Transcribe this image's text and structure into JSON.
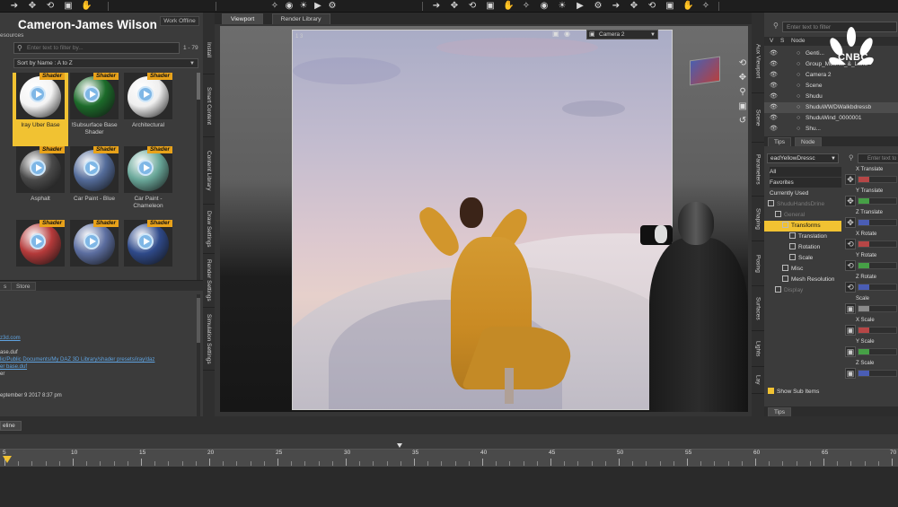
{
  "toolbar": {
    "icons": [
      "select-icon",
      "move-icon",
      "rotate-icon",
      "scale-icon",
      "hand-icon",
      "pan-icon",
      "camera-icon",
      "light-icon",
      "render-icon",
      "settings-icon"
    ]
  },
  "left_panel": {
    "user_name": "Cameron-James Wilson",
    "work_offline": "Work Offline",
    "resources_label": "esources",
    "filter_placeholder": "Enter text to filter by...",
    "count": "1 - 79",
    "sort": "Sort by Name : A to Z",
    "badge_text": "Shader",
    "tiles": [
      {
        "label": "Iray Uber Base",
        "selected": true,
        "color": "#f4f4f4"
      },
      {
        "label": "!Subsurface Base Shader",
        "selected": false,
        "color": "#1c6b2a"
      },
      {
        "label": "Architectural",
        "selected": false,
        "color": "#efefef"
      },
      {
        "label": "Asphalt",
        "selected": false,
        "color": "#4a4a4a"
      },
      {
        "label": "Car Paint - Blue",
        "selected": false,
        "color": "#546c9a"
      },
      {
        "label": "Car Paint - Chameleon",
        "selected": false,
        "color": "#6aa89a"
      },
      {
        "label": "",
        "selected": false,
        "color": "#b53a3a"
      },
      {
        "label": "",
        "selected": false,
        "color": "#5c6ea0"
      },
      {
        "label": "",
        "selected": false,
        "color": "#2f4a8a"
      }
    ],
    "lower_tabs": [
      "s",
      "Store"
    ],
    "info_lines": [
      {
        "text": "z3d.com",
        "link": true
      },
      {
        "text": "",
        "link": false
      },
      {
        "text": "ase.duf",
        "link": false
      },
      {
        "text": "lic/Public Documents/My DAZ 3D Library/shader presets/iray/daz",
        "link": true
      },
      {
        "text": "er base.duf",
        "link": true
      },
      {
        "text": "er",
        "link": false
      },
      {
        "text": "",
        "link": false
      },
      {
        "text": "",
        "link": false
      },
      {
        "text": "eptember 9 2017 8:37 pm",
        "link": false
      }
    ],
    "vtabs": [
      "Install",
      "Smart Content",
      "Content Library",
      "Draw Settings",
      "Render Settings",
      "Simulation Settings"
    ]
  },
  "center": {
    "tabs": [
      {
        "label": "Viewport",
        "active": true
      },
      {
        "label": "Render Library",
        "active": false
      }
    ],
    "camera": "Camera 2",
    "frame_counter": "1 3"
  },
  "right_panel": {
    "vtabs": [
      "Aux Viewport",
      "Scene",
      "Parameters",
      "Shaping",
      "Posing",
      "Surfaces",
      "Lights",
      "Lay"
    ],
    "filter_placeholder": "Enter text to filter",
    "header": {
      "v": "V",
      "s": "S",
      "node": "Node"
    },
    "scene_items": [
      {
        "name": "Genti...",
        "selected": false
      },
      {
        "name": "Group_Mounts_&_Land",
        "selected": false
      },
      {
        "name": "Camera 2",
        "selected": false
      },
      {
        "name": "Scene",
        "selected": false
      },
      {
        "name": "Shudu",
        "selected": false
      },
      {
        "name": "ShuduWWDWalkbdressb",
        "selected": true
      },
      {
        "name": "ShuduWind_0000001",
        "selected": false
      },
      {
        "name": "Shu...",
        "selected": false
      }
    ],
    "scene_tabs": [
      {
        "label": "Tips",
        "active": false
      },
      {
        "label": "Node",
        "active": true
      }
    ],
    "param_select": "eadYellowDressc",
    "param_filter": "Enter text to fi",
    "param_list": [
      {
        "label": "All",
        "highlight": true
      },
      {
        "label": "Favorites",
        "highlight": true
      },
      {
        "label": "Currently Used",
        "highlight": false
      }
    ],
    "param_tree": [
      {
        "label": "ShuduHandsDrine",
        "indent": 0,
        "selected": false,
        "dim": true
      },
      {
        "label": "General",
        "indent": 1,
        "selected": false,
        "dim": true
      },
      {
        "label": "Transforms",
        "indent": 2,
        "selected": true,
        "dim": false
      },
      {
        "label": "Translation",
        "indent": 3,
        "selected": false,
        "dim": false
      },
      {
        "label": "Rotation",
        "indent": 3,
        "selected": false,
        "dim": false
      },
      {
        "label": "Scale",
        "indent": 3,
        "selected": false,
        "dim": false
      },
      {
        "label": "Misc",
        "indent": 2,
        "selected": false,
        "dim": false
      },
      {
        "label": "Mesh Resolution",
        "indent": 2,
        "selected": false,
        "dim": false
      },
      {
        "label": "Display",
        "indent": 1,
        "selected": false,
        "dim": true
      }
    ],
    "show_sub_items": "Show Sub Items",
    "bottom_tab": "Tips",
    "sliders": [
      {
        "label": "X Translate",
        "color": "#b64646",
        "icon": "move"
      },
      {
        "label": "Y Translate",
        "color": "#46a046",
        "icon": "move"
      },
      {
        "label": "Z Translate",
        "color": "#4a5db5",
        "icon": "move"
      },
      {
        "label": "X Rotate",
        "color": "#b64646",
        "icon": "rotate"
      },
      {
        "label": "Y Rotate",
        "color": "#46a046",
        "icon": "rotate"
      },
      {
        "label": "Z Rotate",
        "color": "#4a5db5",
        "icon": "rotate"
      },
      {
        "label": "Scale",
        "color": "#8a8a8a",
        "icon": "scale"
      },
      {
        "label": "X Scale",
        "color": "#b64646",
        "icon": "scale"
      },
      {
        "label": "Y Scale",
        "color": "#46a046",
        "icon": "scale"
      },
      {
        "label": "Z Scale",
        "color": "#4a5db5",
        "icon": "scale"
      }
    ]
  },
  "timeline": {
    "tab": "eline",
    "ticks": [
      "5",
      "10",
      "15",
      "20",
      "25",
      "30",
      "35",
      "40",
      "45",
      "50",
      "55",
      "60",
      "65",
      "70"
    ]
  },
  "watermark": "CNBC",
  "colors": {
    "accent": "#f1c232",
    "badge": "#e8a21a",
    "link": "#5fa3e0"
  }
}
